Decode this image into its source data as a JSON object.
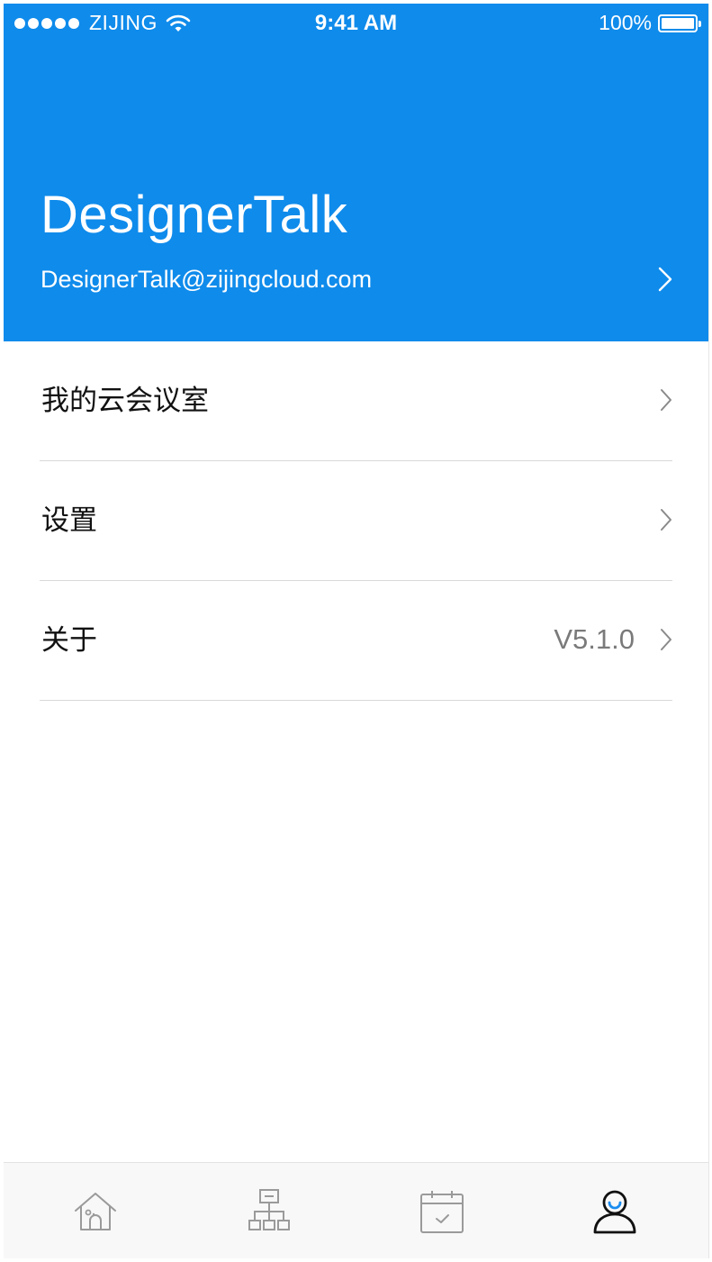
{
  "status_bar": {
    "carrier": "ZIJING",
    "time": "9:41 AM",
    "battery": "100%",
    "signal_bars": 5
  },
  "profile": {
    "name": "DesignerTalk",
    "email": "DesignerTalk@zijingcloud.com"
  },
  "menu": {
    "items": [
      {
        "label": "我的云会议室",
        "value": ""
      },
      {
        "label": "设置",
        "value": ""
      },
      {
        "label": "关于",
        "value": "V5.1.0"
      }
    ]
  },
  "tab_bar": {
    "tabs": [
      {
        "icon": "home-icon",
        "active": false
      },
      {
        "icon": "organization-icon",
        "active": false
      },
      {
        "icon": "calendar-icon",
        "active": false
      },
      {
        "icon": "profile-icon",
        "active": true
      }
    ]
  },
  "colors": {
    "header_bg": "#0f8beb",
    "accent": "#1a8cf0",
    "divider": "#d9d9d9",
    "muted_text": "#7a7a7a",
    "icon_gray": "#9a9a9a",
    "icon_active": "#111111"
  }
}
